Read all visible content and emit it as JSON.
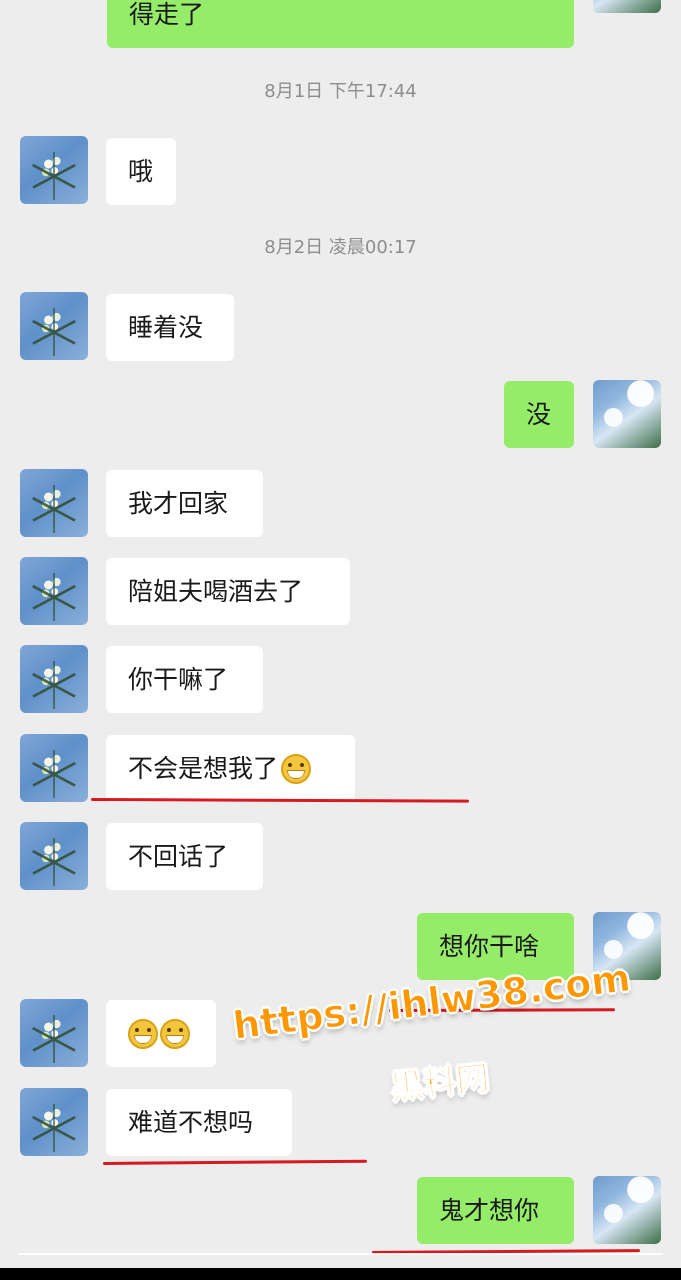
{
  "chat": {
    "messages": {
      "m0": {
        "text": "得走了"
      },
      "m1": {
        "text": "哦"
      },
      "m2": {
        "text": "睡着没"
      },
      "m3": {
        "text": "没"
      },
      "m4": {
        "text": "我才回家"
      },
      "m5": {
        "text": "陪姐夫喝酒去了"
      },
      "m6": {
        "text": "你干嘛了"
      },
      "m7": {
        "text": "不会是想我了"
      },
      "m8": {
        "text": "不回话了"
      },
      "m9": {
        "text": "想你干啥"
      },
      "m11": {
        "text": "难道不想吗"
      },
      "m12": {
        "text": "鬼才想你"
      }
    },
    "timestamps": {
      "t1": "8月1日 下午17:44",
      "t2": "8月2日 凌晨00:17"
    }
  },
  "watermark": {
    "line1": "https://ihlw38.com",
    "line2": "黑料网"
  },
  "colors": {
    "background": "#ededed",
    "incoming_bubble": "#ffffff",
    "outgoing_bubble": "#95ec69",
    "timestamp": "#8d8d8d",
    "underline": "#d71920",
    "watermark": "#ff9800"
  },
  "icons": {
    "emoji": "grinning-face-icon"
  }
}
